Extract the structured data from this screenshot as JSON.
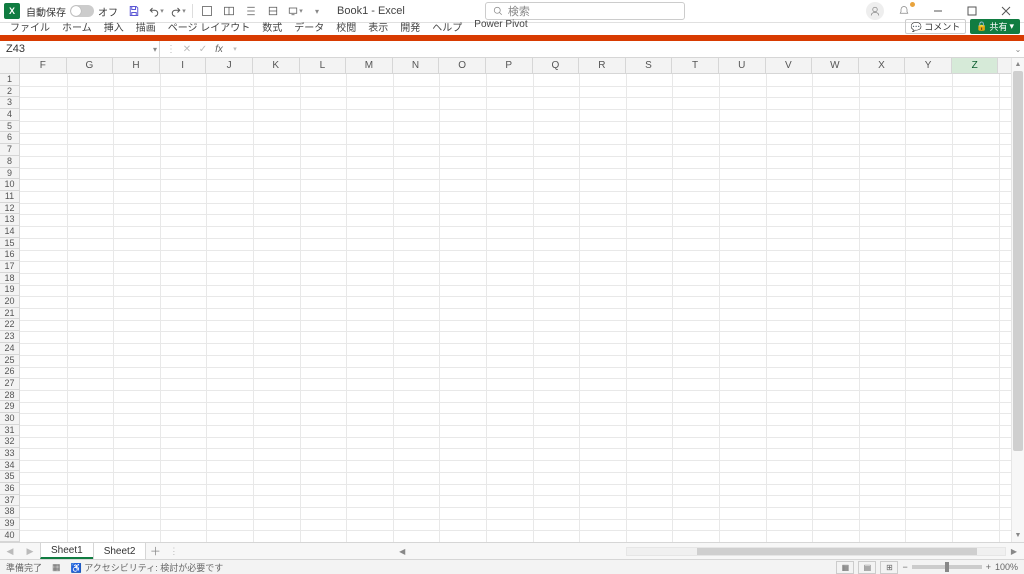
{
  "titlebar": {
    "autosave_label": "自動保存",
    "autosave_state": "オフ",
    "doc_title": "Book1 - Excel",
    "search_placeholder": "検索"
  },
  "menu": {
    "tabs": [
      "ファイル",
      "ホーム",
      "挿入",
      "描画",
      "ページ レイアウト",
      "数式",
      "データ",
      "校閲",
      "表示",
      "開発",
      "ヘルプ",
      "Power Pivot"
    ],
    "comment": "コメント",
    "share": "共有"
  },
  "namebox": {
    "value": "Z43"
  },
  "columns": [
    "F",
    "G",
    "H",
    "I",
    "J",
    "K",
    "L",
    "M",
    "N",
    "O",
    "P",
    "Q",
    "R",
    "S",
    "T",
    "U",
    "V",
    "W",
    "X",
    "Y",
    "Z"
  ],
  "selected_column": "Z",
  "rows_start": 1,
  "rows_end": 40,
  "sheets": {
    "tabs": [
      "Sheet1",
      "Sheet2"
    ],
    "active": 0
  },
  "status": {
    "ready": "準備完了",
    "accessibility": "アクセシビリティ: 検討が必要です",
    "zoom": "100%"
  }
}
